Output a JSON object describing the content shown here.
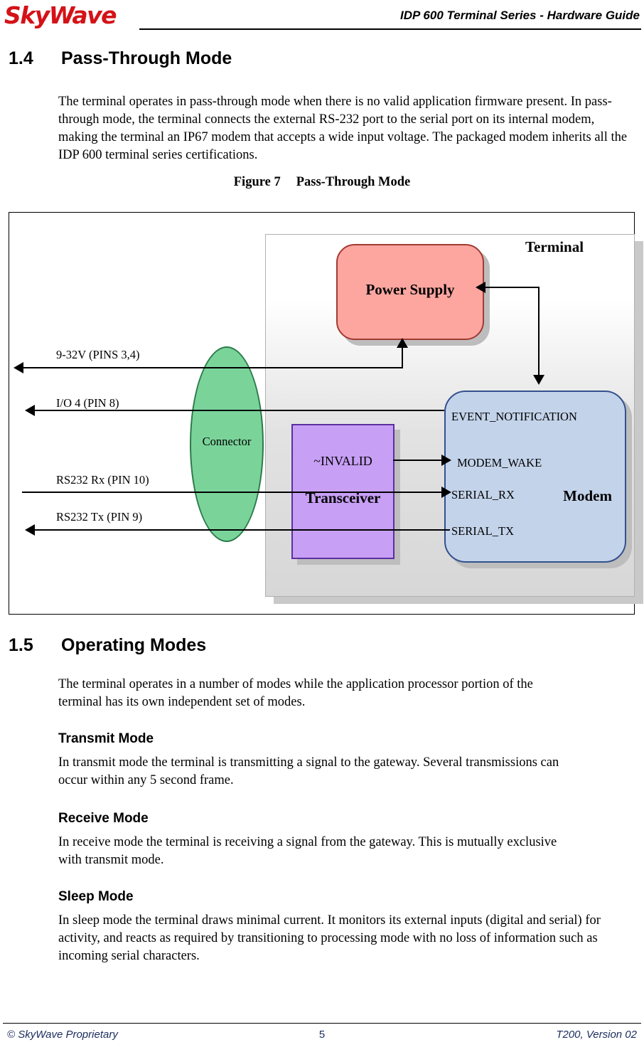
{
  "header": {
    "logo_text": "SkyWave",
    "title": "IDP 600 Terminal Series - Hardware Guide"
  },
  "sections": {
    "s14_number": "1.4",
    "s14_title": "Pass-Through Mode",
    "s14_body": "The terminal operates in pass-through mode when there is no valid application firmware present. In pass-through mode, the terminal connects the external RS-232 port to the serial port on its internal modem, making the terminal an IP67 modem that accepts a wide input voltage. The packaged modem inherits all the IDP 600 terminal series certifications.",
    "figure_caption_label": "Figure 7",
    "figure_caption_title": "Pass-Through Mode",
    "s15_number": "1.5",
    "s15_title": "Operating Modes",
    "s15_body": "The terminal operates in a number of modes while the application processor portion of the terminal has its own independent set of modes.",
    "transmit_heading": "Transmit Mode",
    "transmit_body": "In transmit mode the terminal is transmitting a signal to the gateway. Several transmissions can occur within any 5 second frame.",
    "receive_heading": "Receive Mode",
    "receive_body": "In receive mode the terminal is receiving a signal from the gateway. This is mutually exclusive with transmit mode.",
    "sleep_heading": "Sleep Mode",
    "sleep_body": "In sleep mode the terminal draws minimal current. It monitors its external inputs (digital and serial) for activity, and reacts as required by transitioning to processing mode with no loss of information such as incoming serial characters."
  },
  "figure": {
    "terminal_label": "Terminal",
    "power_supply_label": "Power Supply",
    "connector_label": "Connector",
    "transceiver_invalid": "~INVALID",
    "transceiver_label": "Transceiver",
    "modem_label": "Modem",
    "modem_signals": [
      "EVENT_NOTIFICATION",
      "MODEM_WAKE",
      "SERIAL_RX",
      "SERIAL_TX"
    ],
    "pin_labels": [
      "9-32V (PINS 3,4)",
      "I/O 4 (PIN 8)",
      "RS232 Rx (PIN 10)",
      "RS232 Tx (PIN 9)"
    ],
    "colors": {
      "power_supply": "#fda6a0",
      "connector": "#7ad49a",
      "transceiver": "#c79ff5",
      "modem": "#c3d3ea",
      "terminal_panel": "#dcdcdc"
    }
  },
  "footer": {
    "left": "© SkyWave Proprietary",
    "center": "5",
    "right": "T200, Version 02"
  }
}
